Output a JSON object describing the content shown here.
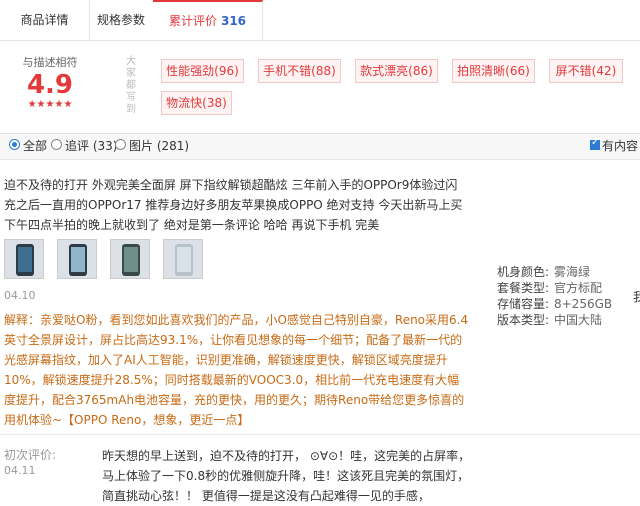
{
  "tabs": [
    {
      "label": "商品详情"
    },
    {
      "label": "规格参数"
    },
    {
      "label": "累计评价",
      "count": "316"
    }
  ],
  "rating": {
    "label": "与描述相符",
    "score": "4.9",
    "stars": "★★★★★"
  },
  "tags_side_label": "大家都写到",
  "tags": [
    {
      "label": "性能强劲(96)"
    },
    {
      "label": "手机不错(88)"
    },
    {
      "label": "款式漂亮(86)"
    },
    {
      "label": "拍照清晰(66)"
    },
    {
      "label": "屏不错(42)"
    },
    {
      "label": "物流快(38)"
    }
  ],
  "filter": {
    "all": "全部",
    "followup": "追评 (33)",
    "images": "图片 (281)",
    "has_content": "有内容"
  },
  "review": {
    "text": "迫不及待的打开 外观完美全面屏 屏下指纹解锁超酷炫 三年前入手的OPPOr9体验过闪充之后一直用的OPPOr17 推荐身边好多朋友苹果换成OPPO 绝对支持 今天出新马上买 下午四点半拍的晚上就收到了 绝对是第一条评论 哈哈 再说下手机 完美",
    "date": "04.10",
    "reply": "解释：亲爱哒O粉，看到您如此喜欢我们的产品，小O感觉自己特别自豪，Reno采用6.4英寸全景屏设计，屏占比高达93.1%，让你看见想象的每一个细节；配备了最新一代的光感屏幕指纹，加入了AI人工智能，识别更准确，解锁速度更快，解锁区域亮度提升10%，解锁速度提升28.5%；同时搭载最新的VOOC3.0，相比前一代充电速度有大幅度提升，配合3765mAh电池容量，充的更快，用的更久；期待Reno带给您更多惊喜的用机体验~【OPPO Reno，想象，更近一点】"
  },
  "specs": [
    {
      "key": "机身颜色:",
      "value": "雾海绿"
    },
    {
      "key": "套餐类型:",
      "value": "官方标配"
    },
    {
      "key": "存储容量:",
      "value": "8+256GB"
    },
    {
      "key": "版本类型:",
      "value": "中国大陆"
    }
  ],
  "edge_char": "我",
  "first_review": {
    "label": "初次评价:",
    "date": "04.11",
    "text": "昨天想的早上送到，迫不及待的打开， ⊙∀⊙！哇，这完美的占屏率，马上体验了一下0.8秒的优雅侧旋升降，哇！这该死且完美的氛围灯，简直挑动心弦！！ 更值得一提是这没有凸起难得一见的手感，"
  }
}
